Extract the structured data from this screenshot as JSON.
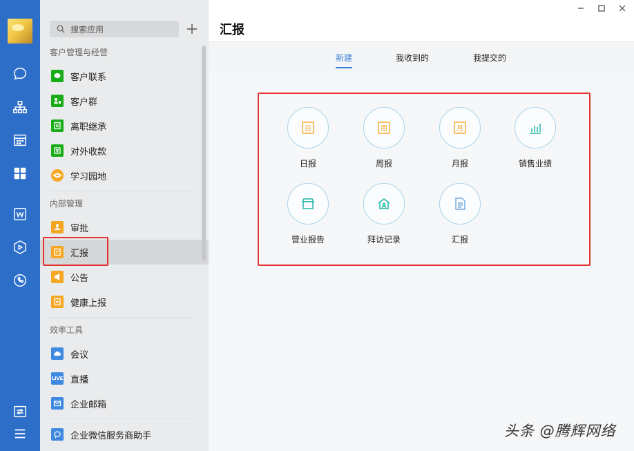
{
  "sidebar": {
    "search_placeholder": "搜索应用",
    "sections": [
      {
        "title": "客户管理与经营",
        "items": [
          "客户联系",
          "客户群",
          "离职继承",
          "对外收款",
          "学习园地"
        ]
      },
      {
        "title": "内部管理",
        "items": [
          "审批",
          "汇报",
          "公告",
          "健康上报"
        ]
      },
      {
        "title": "效率工具",
        "items": [
          "会议",
          "直播",
          "企业邮箱"
        ]
      }
    ],
    "bottom_item": "企业微信服务商助手",
    "live_badge": "LIVE"
  },
  "main": {
    "title": "汇报",
    "tabs": [
      "新建",
      "我收到的",
      "我提交的"
    ],
    "tiles": [
      {
        "label": "日报",
        "glyph": "日"
      },
      {
        "label": "周报",
        "glyph": "周"
      },
      {
        "label": "月报",
        "glyph": "月"
      },
      {
        "label": "销售业绩"
      },
      {
        "label": "营业报告"
      },
      {
        "label": "拜访记录"
      },
      {
        "label": "汇报"
      }
    ]
  },
  "watermark": "头条 @腾辉网络",
  "colors": {
    "rail": "#2d6fc8",
    "accent": "#3a7fd6",
    "highlight": "#e53030",
    "tile_orange": "#f5a623",
    "tile_teal": "#1fb8a8"
  }
}
